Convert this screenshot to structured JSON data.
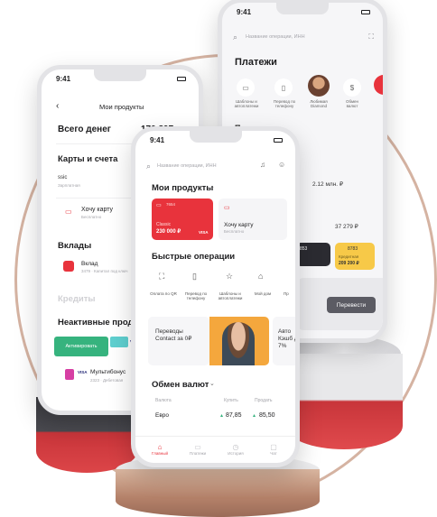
{
  "colors": {
    "accent": "#e8333c",
    "green": "#36b37e",
    "yellow": "#f7c948",
    "dark": "#2b2b31",
    "gold": "#c79a83"
  },
  "status_time": "9:41",
  "right_phone": {
    "search_placeholder": "Название операции, ИНН",
    "title": "Платежи",
    "actions": [
      {
        "label": "Шаблоны и автоплатежи",
        "icon": "template-icon"
      },
      {
        "label": "Перевод по телефону",
        "icon": "phone-transfer-icon"
      },
      {
        "label": "Любимая Diamond",
        "icon": "avatar"
      },
      {
        "label": "Обмен валют",
        "icon": "exchange-icon"
      }
    ],
    "section_label": "Переводы",
    "amounts": [
      "2.12 млн. ₽",
      "37 279 ₽"
    ],
    "mini_cards": [
      {
        "num": "853"
      },
      {
        "num": "8783",
        "label": "Кредитная",
        "amount": "209 200 ₽"
      }
    ],
    "transfer_button": "Перевести"
  },
  "left_phone": {
    "title": "Мои продукты",
    "total_label": "Всего денег",
    "total_value": "170 897",
    "cards_section": "Карты и счета",
    "cards_count": "170",
    "card_row": {
      "name": "Classic",
      "sub": "Зарплатная",
      "card_no": "ssic"
    },
    "want_card": {
      "title": "Хочу карту",
      "sub": "Бесплатно"
    },
    "deposits_section": "Вклады",
    "deposit": {
      "name": "Вклад",
      "sub": "3479 · Капитал под ключ"
    },
    "credits_section": "Кредиты",
    "inactive_section": "Неактивные проду",
    "activate_button": "Активировать",
    "inactive_visa": "VISA",
    "multibonus": {
      "brand": "VISA",
      "name": "Мультибонус",
      "sub": "2323 · Дебетовая"
    }
  },
  "center_phone": {
    "search_placeholder": "Название операции, ИНН",
    "products_title": "Мои продукты",
    "red_card": {
      "num": "7654",
      "name": "Classic",
      "amount": "230 000 ₽",
      "brand": "VISA"
    },
    "want_card": {
      "title": "Хочу карту",
      "sub": "Бесплатно"
    },
    "quick_title": "Быстрые операции",
    "quick": [
      {
        "label": "Оплата по QR",
        "icon": "qr-icon"
      },
      {
        "label": "Перевод по телефону",
        "icon": "phone-icon"
      },
      {
        "label": "Шаблоны и автоплатежи",
        "icon": "star-icon"
      },
      {
        "label": "Мой дом",
        "icon": "home-icon"
      },
      {
        "label": "Пр",
        "icon": "more-icon"
      }
    ],
    "promo1": "Переводы Contact за 0₽",
    "promo2": "Авто Кэшб до 7%",
    "fx_title": "Обмен валют",
    "fx_head": {
      "currency": "Валюта",
      "buy": "Купить",
      "sell": "Продать"
    },
    "fx_row": {
      "currency": "Евро",
      "buy": "87,85",
      "sell": "85,50"
    },
    "tabs": [
      {
        "label": "Главный",
        "icon": "home-tab-icon"
      },
      {
        "label": "Платежи",
        "icon": "payments-tab-icon"
      },
      {
        "label": "История",
        "icon": "history-tab-icon"
      },
      {
        "label": "Чат",
        "icon": "chat-tab-icon"
      }
    ]
  }
}
